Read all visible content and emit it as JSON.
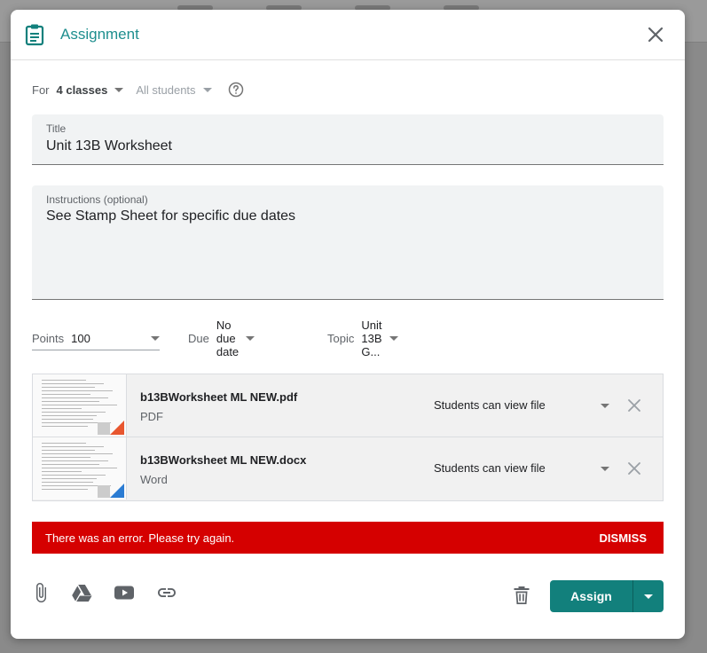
{
  "dialog": {
    "title": "Assignment"
  },
  "for": {
    "label": "For",
    "classes": "4 classes",
    "students": "All students"
  },
  "title_field": {
    "label": "Title",
    "value": "Unit 13B Worksheet"
  },
  "instructions_field": {
    "label": "Instructions (optional)",
    "value": "See Stamp Sheet for specific due dates"
  },
  "meta": {
    "points_label": "Points",
    "points_value": "100",
    "due_label": "Due",
    "due_value": "No due date",
    "topic_label": "Topic",
    "topic_value": "Unit 13B G..."
  },
  "attachments": [
    {
      "name": "b13BWorksheet ML NEW.pdf",
      "type": "PDF",
      "permission": "Students can view file"
    },
    {
      "name": "b13BWorksheet ML NEW.docx",
      "type": "Word",
      "permission": "Students can view file"
    }
  ],
  "error": {
    "message": "There was an error. Please try again.",
    "dismiss": "DISMISS"
  },
  "actions": {
    "assign_label": "Assign"
  },
  "colors": {
    "accent": "#12807c",
    "title_teal": "#1e8e8e",
    "error_red": "#d50000"
  },
  "icons": {
    "header": "clipboard-icon",
    "close": "close-icon",
    "help": "help-icon",
    "toolbar": [
      "paperclip-icon",
      "drive-icon",
      "youtube-icon",
      "link-icon"
    ],
    "trash": "trash-icon",
    "remove": "close-icon"
  }
}
